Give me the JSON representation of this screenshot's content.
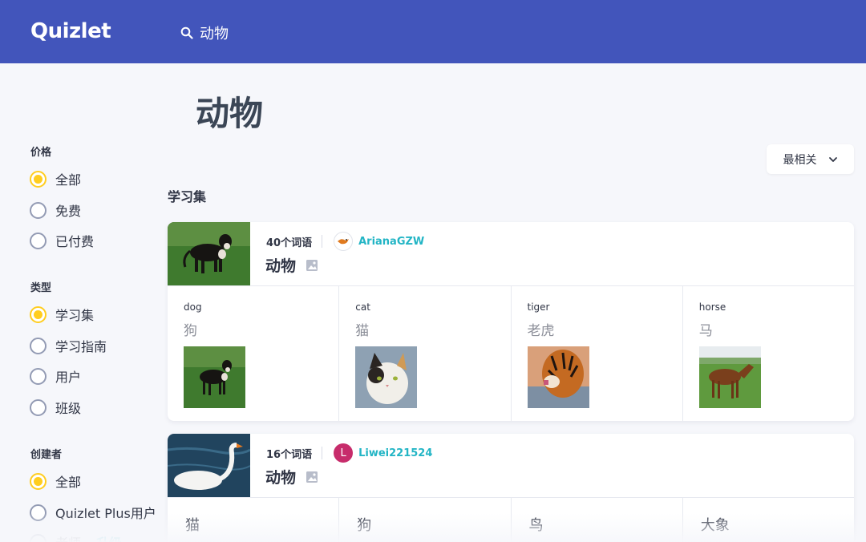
{
  "header": {
    "logo": "Quizlet",
    "search": {
      "value": "动物"
    }
  },
  "page": {
    "title": "动物"
  },
  "sidebar": {
    "groups": [
      {
        "label": "价格",
        "options": [
          {
            "label": "全部",
            "selected": true
          },
          {
            "label": "免费",
            "selected": false
          },
          {
            "label": "已付费",
            "selected": false
          }
        ]
      },
      {
        "label": "类型",
        "options": [
          {
            "label": "学习集",
            "selected": true
          },
          {
            "label": "学习指南",
            "selected": false
          },
          {
            "label": "用户",
            "selected": false
          },
          {
            "label": "班级",
            "selected": false
          }
        ]
      },
      {
        "label": "创建者",
        "options": [
          {
            "label": "全部",
            "selected": true
          },
          {
            "label": "Quizlet Plus用户",
            "selected": false
          },
          {
            "label": "老师",
            "selected": false,
            "badge": "升级"
          }
        ]
      }
    ]
  },
  "sort": {
    "label": "最相关",
    "icon": "chevron-down-icon"
  },
  "results": {
    "section_title": "学习集",
    "sets": [
      {
        "term_count": "40个词语",
        "username": "ArianaGZW",
        "title": "动物",
        "terms": [
          {
            "term": "dog",
            "definition": "狗",
            "image": "dog-image"
          },
          {
            "term": "cat",
            "definition": "猫",
            "image": "cat-image"
          },
          {
            "term": "tiger",
            "definition": "老虎",
            "image": "tiger-image"
          },
          {
            "term": "horse",
            "definition": "马",
            "image": "horse-image"
          }
        ]
      },
      {
        "term_count": "16个词语",
        "username": "Liwei221524",
        "avatar_letter": "L",
        "avatar_color": "#c72c6b",
        "title": "动物",
        "terms": [
          {
            "term": "猫"
          },
          {
            "term": "狗"
          },
          {
            "term": "鸟"
          },
          {
            "term": "大象"
          }
        ]
      }
    ]
  },
  "colors": {
    "header": "#4255bb",
    "accent_yellow": "#ffcd1f",
    "link_teal": "#23b5c5"
  }
}
